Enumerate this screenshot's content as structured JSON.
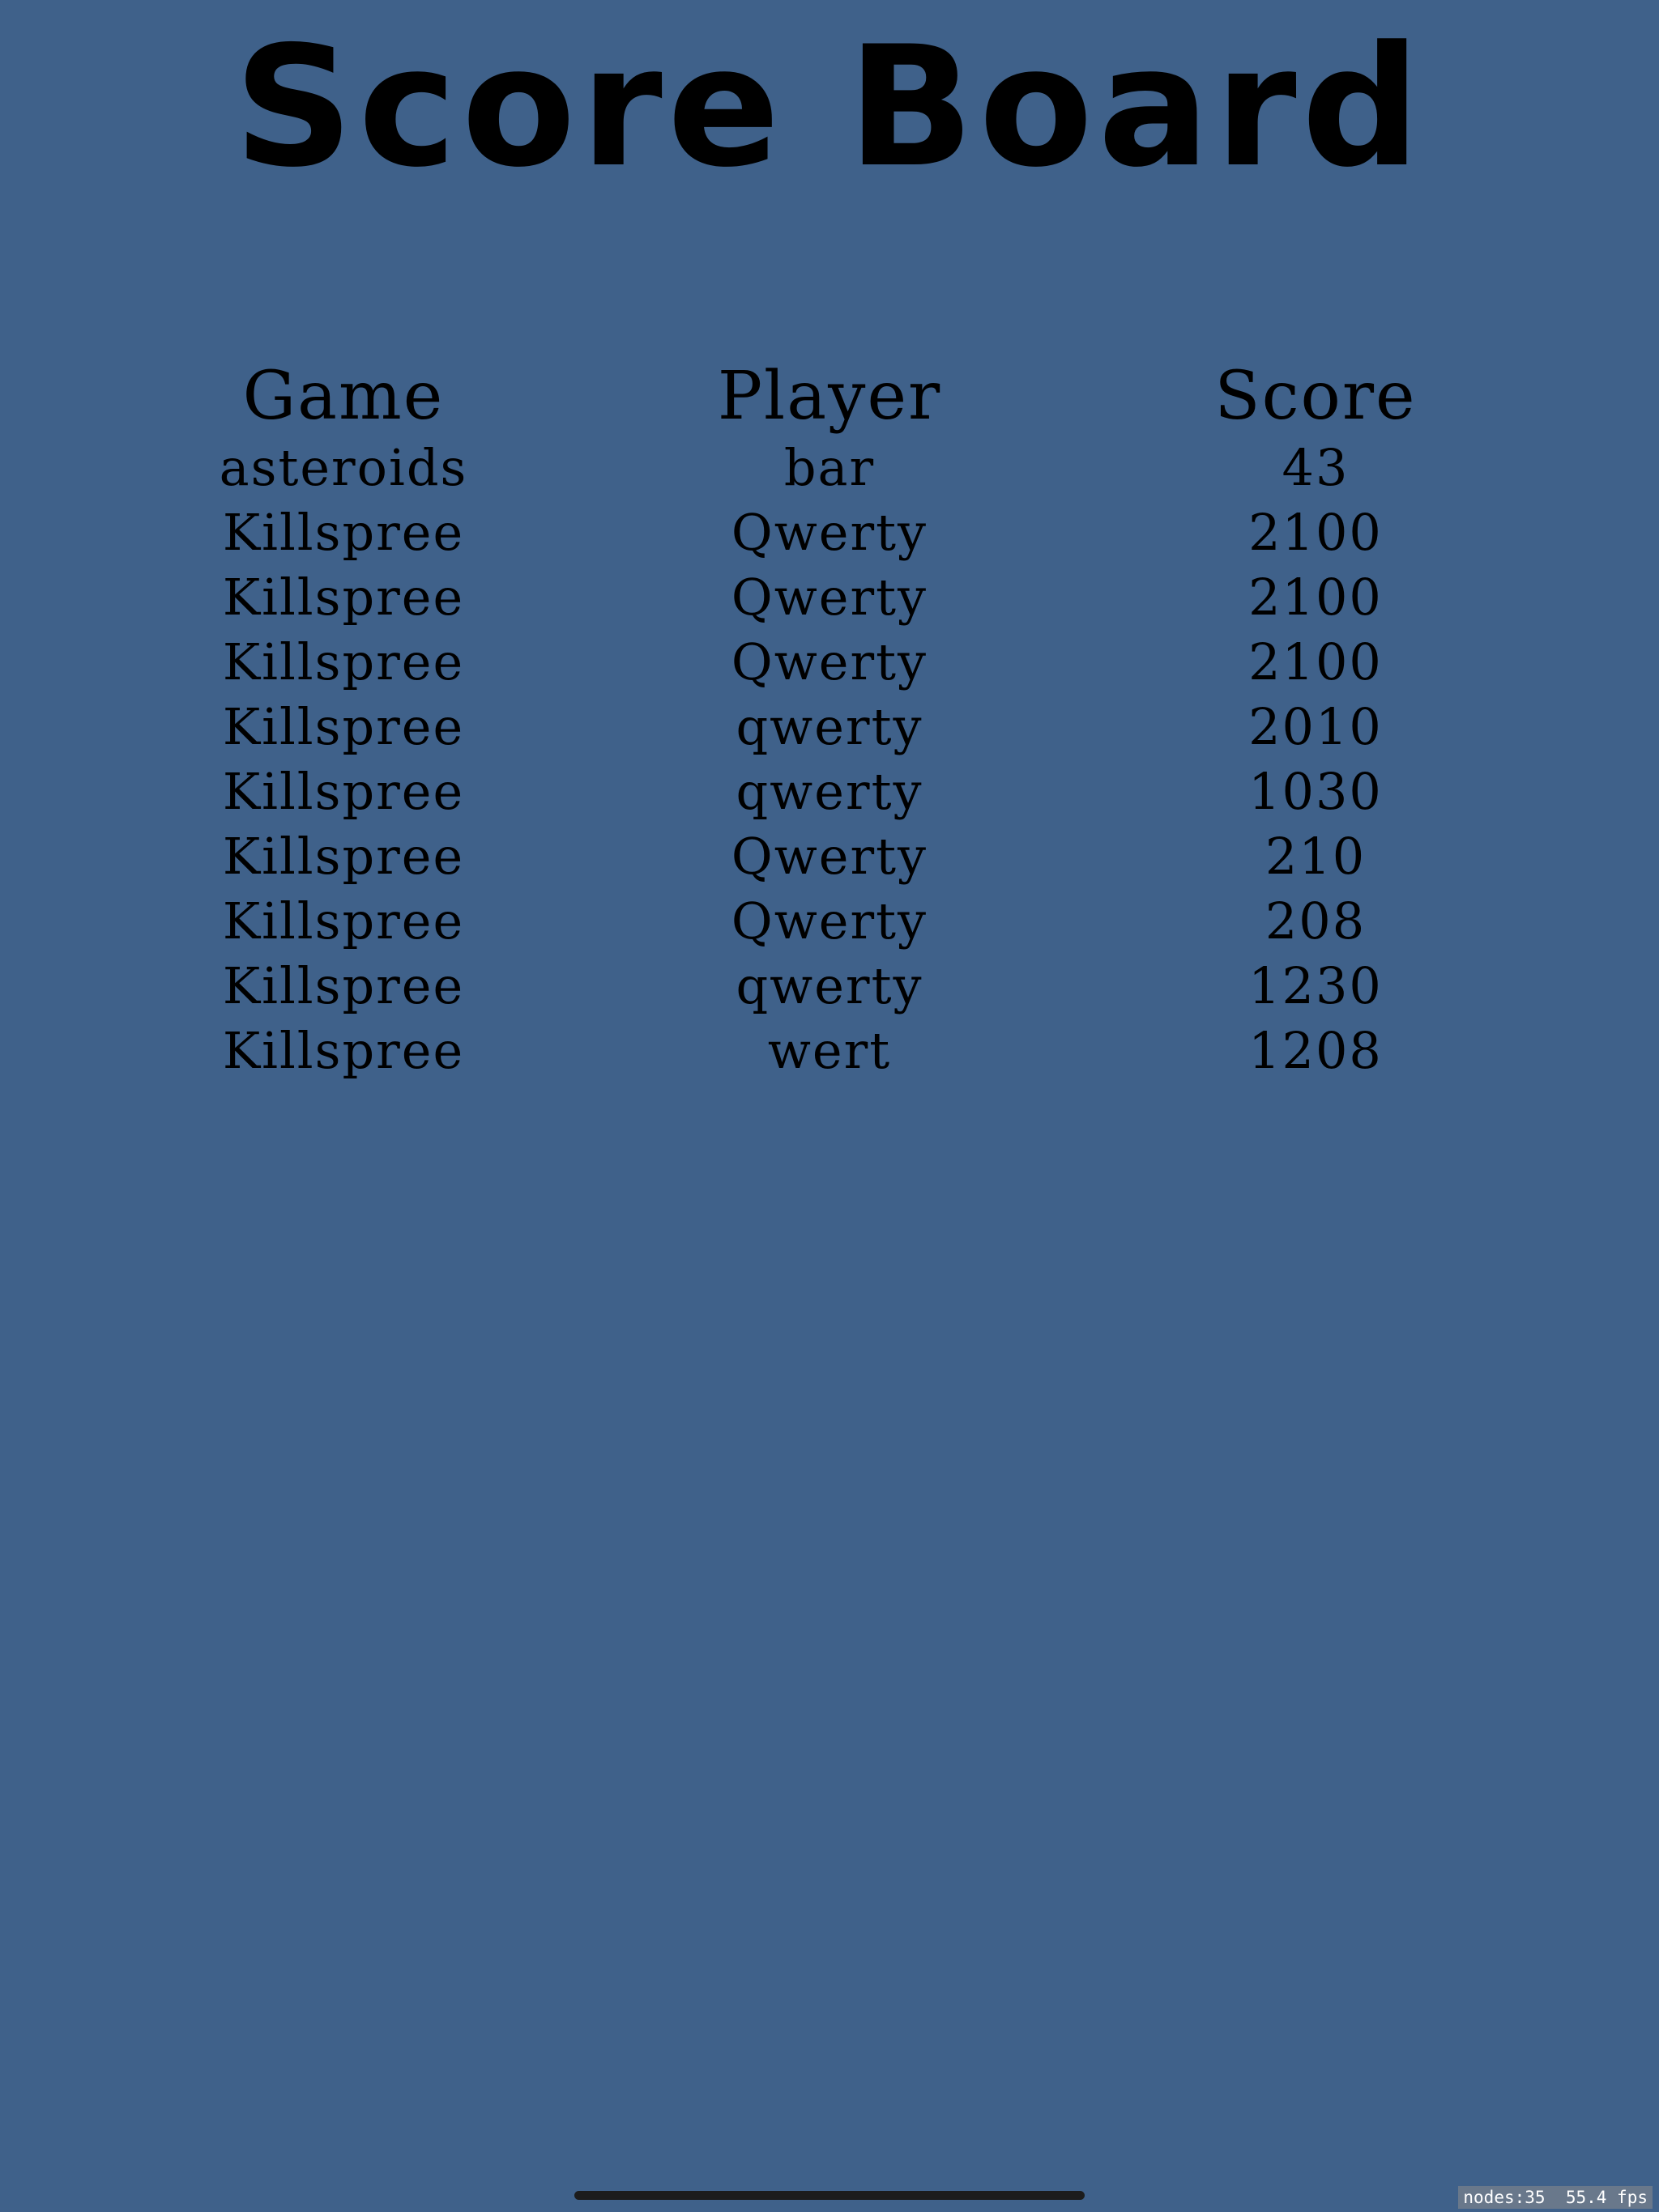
{
  "title": "Score Board",
  "headers": {
    "game": "Game",
    "player": "Player",
    "score": "Score"
  },
  "rows": [
    {
      "game": "asteroids",
      "player": "bar",
      "score": "43"
    },
    {
      "game": "Killspree",
      "player": "Qwerty",
      "score": "2100"
    },
    {
      "game": "Killspree",
      "player": "Qwerty",
      "score": "2100"
    },
    {
      "game": "Killspree",
      "player": "Qwerty",
      "score": "2100"
    },
    {
      "game": "Killspree",
      "player": "qwerty",
      "score": "2010"
    },
    {
      "game": "Killspree",
      "player": "qwerty",
      "score": "1030"
    },
    {
      "game": "Killspree",
      "player": "Qwerty",
      "score": "210"
    },
    {
      "game": "Killspree",
      "player": "Qwerty",
      "score": "208"
    },
    {
      "game": "Killspree",
      "player": "qwerty",
      "score": "1230"
    },
    {
      "game": "Killspree",
      "player": "wert",
      "score": "1208"
    }
  ],
  "debug": {
    "nodes": "nodes:35",
    "fps": "55.4 fps"
  },
  "colors": {
    "background": "#3f618a",
    "text": "#000000"
  }
}
